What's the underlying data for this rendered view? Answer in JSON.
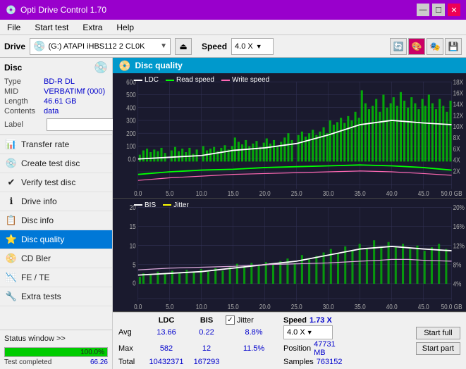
{
  "app": {
    "title": "Opti Drive Control 1.70",
    "icon": "💿"
  },
  "titlebar": {
    "title": "Opti Drive Control 1.70",
    "minimize": "—",
    "maximize": "☐",
    "close": "✕"
  },
  "menu": {
    "items": [
      "File",
      "Start test",
      "Extra",
      "Help"
    ]
  },
  "drivebar": {
    "label": "Drive",
    "drive_value": "(G:) ATAPI iHBS112  2 CL0K",
    "speed_label": "Speed",
    "speed_value": "4.0 X"
  },
  "disc": {
    "title": "Disc",
    "type_label": "Type",
    "type_val": "BD-R DL",
    "mid_label": "MID",
    "mid_val": "VERBATIMf (000)",
    "length_label": "Length",
    "length_val": "46.61 GB",
    "contents_label": "Contents",
    "contents_val": "data",
    "label_label": "Label",
    "label_val": ""
  },
  "nav": {
    "items": [
      {
        "id": "transfer-rate",
        "label": "Transfer rate",
        "icon": "📊"
      },
      {
        "id": "create-test-disc",
        "label": "Create test disc",
        "icon": "💿"
      },
      {
        "id": "verify-test-disc",
        "label": "Verify test disc",
        "icon": "✔"
      },
      {
        "id": "drive-info",
        "label": "Drive info",
        "icon": "ℹ"
      },
      {
        "id": "disc-info",
        "label": "Disc info",
        "icon": "📋"
      },
      {
        "id": "disc-quality",
        "label": "Disc quality",
        "icon": "⭐",
        "active": true
      },
      {
        "id": "cd-bler",
        "label": "CD Bler",
        "icon": "📀"
      },
      {
        "id": "fe-te",
        "label": "FE / TE",
        "icon": "📉"
      },
      {
        "id": "extra-tests",
        "label": "Extra tests",
        "icon": "🔧"
      }
    ]
  },
  "status": {
    "window_label": "Status window >>",
    "progress_pct": 100,
    "progress_text": "100.0%",
    "completed_label": "Test completed",
    "right_val": "66.26"
  },
  "chart_header": {
    "title": "Disc quality"
  },
  "legend1": {
    "ldc": {
      "label": "LDC",
      "color": "#ffffff"
    },
    "read": {
      "label": "Read speed",
      "color": "#00ff00"
    },
    "write": {
      "label": "Write speed",
      "color": "#ff69b4"
    }
  },
  "legend2": {
    "bis": {
      "label": "BIS",
      "color": "#ffffff"
    },
    "jitter": {
      "label": "Jitter",
      "color": "#ffff00"
    }
  },
  "stats": {
    "headers": [
      "",
      "LDC",
      "BIS",
      "",
      "Jitter",
      "Speed",
      ""
    ],
    "avg_label": "Avg",
    "avg_ldc": "13.66",
    "avg_bis": "0.22",
    "avg_jitter": "8.8%",
    "avg_speed": "1.73 X",
    "avg_speed_sel": "4.0 X",
    "max_label": "Max",
    "max_ldc": "582",
    "max_bis": "12",
    "max_jitter": "11.5%",
    "pos_label": "Position",
    "pos_val": "47731 MB",
    "total_label": "Total",
    "total_ldc": "10432371",
    "total_bis": "167293",
    "samples_label": "Samples",
    "samples_val": "763152",
    "btn_start_full": "Start full",
    "btn_start_part": "Start part",
    "jitter_checked": true,
    "jitter_label": "Jitter"
  }
}
